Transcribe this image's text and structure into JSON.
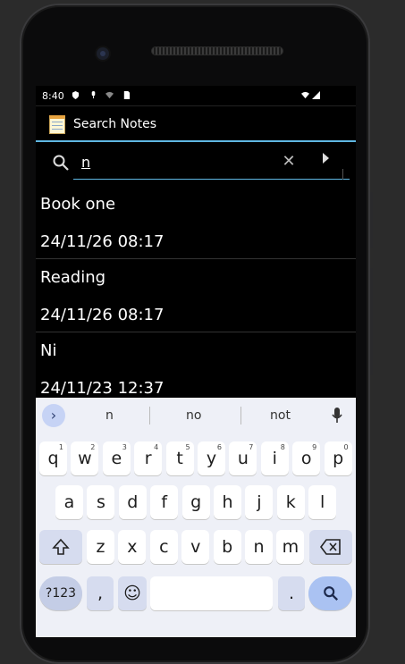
{
  "status_bar": {
    "time": "8:40"
  },
  "app_bar": {
    "title": "Search Notes"
  },
  "search": {
    "query": "n",
    "clear_icon": "close-icon",
    "submit_icon": "arrow-right-icon"
  },
  "notes": [
    {
      "title": "Book one",
      "date": "24/11/26 08:17"
    },
    {
      "title": "Reading",
      "date": "24/11/26 08:17"
    },
    {
      "title": "Ni",
      "date": "24/11/23 12:37"
    }
  ],
  "keyboard": {
    "suggestions": [
      "n",
      "no",
      "not"
    ],
    "row1": [
      {
        "k": "q",
        "n": "1"
      },
      {
        "k": "w",
        "n": "2"
      },
      {
        "k": "e",
        "n": "3"
      },
      {
        "k": "r",
        "n": "4"
      },
      {
        "k": "t",
        "n": "5"
      },
      {
        "k": "y",
        "n": "6"
      },
      {
        "k": "u",
        "n": "7"
      },
      {
        "k": "i",
        "n": "8"
      },
      {
        "k": "o",
        "n": "9"
      },
      {
        "k": "p",
        "n": "0"
      }
    ],
    "row2": [
      "a",
      "s",
      "d",
      "f",
      "g",
      "h",
      "j",
      "k",
      "l"
    ],
    "row3": [
      "z",
      "x",
      "c",
      "v",
      "b",
      "n",
      "m"
    ],
    "symbols_label": "?123",
    "comma": ",",
    "emoji": "☺",
    "period": ".",
    "accent_color": "#5fb7e2"
  }
}
